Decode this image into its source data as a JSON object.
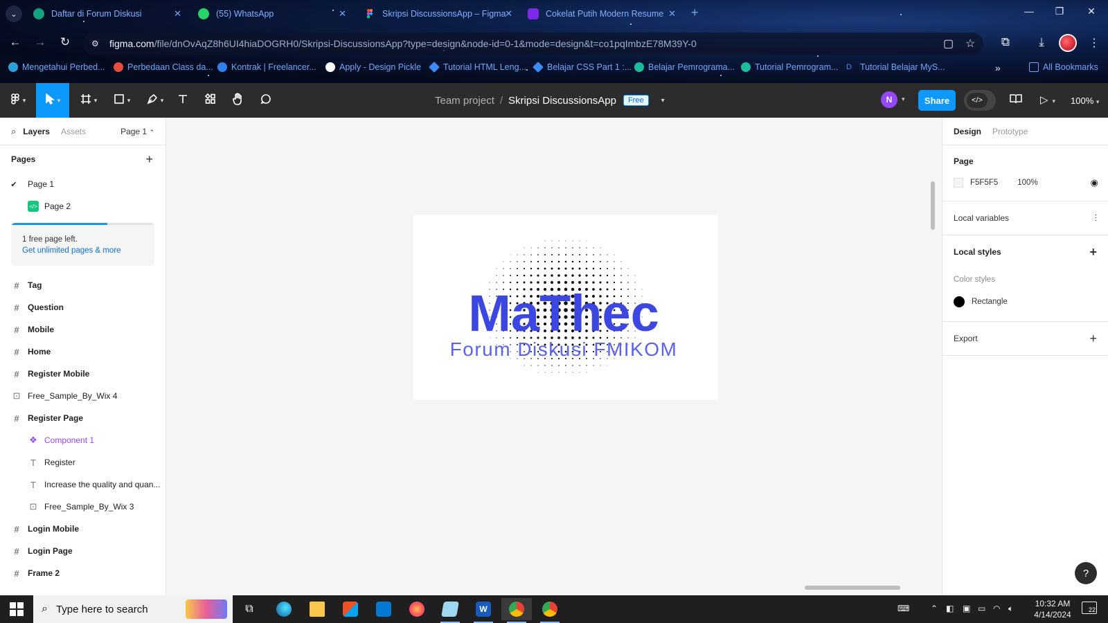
{
  "browser": {
    "tabs": [
      {
        "title": "Daftar di Forum Diskusi",
        "icon": "chatgpt-icon",
        "color": "#10a37f"
      },
      {
        "title": "(55) WhatsApp",
        "icon": "whatsapp-icon",
        "color": "#25d366"
      },
      {
        "title": "Skripsi DiscussionsApp – Figma",
        "icon": "figma-icon",
        "color": "#f24e1e"
      },
      {
        "title": "Cokelat Putih Modern Resume",
        "icon": "canva-icon",
        "color": "#7d2ae8"
      }
    ],
    "url_host": "figma.com",
    "url_path": "/file/dnOvAqZ8h6UI4hiaDOGRH0/Skripsi-DiscussionsApp?type=design&node-id=0-1&mode=design&t=co1pqImbzE78M39Y-0",
    "bookmarks": [
      {
        "label": "Mengetahui Perbed...",
        "color": "#2b9fd9"
      },
      {
        "label": "Perbedaan Class da...",
        "color": "#e74c3c"
      },
      {
        "label": "Kontrak | Freelancer...",
        "color": "#2f80ed"
      },
      {
        "label": "Apply - Design Pickle",
        "color": "#ffffff"
      },
      {
        "label": "Tutorial HTML Leng...",
        "color": "#3d8bff"
      },
      {
        "label": "Belajar CSS Part 1 :...",
        "color": "#3d8bff"
      },
      {
        "label": "Belajar Pemrograma...",
        "color": "#1abc9c"
      },
      {
        "label": "Tutorial Pemrogram...",
        "color": "#1abc9c"
      },
      {
        "label": "Tutorial Belajar MyS...",
        "color": "#3d8bff"
      }
    ],
    "all_bookmarks": "All Bookmarks"
  },
  "figma": {
    "toolbar": {
      "team": "Team project",
      "separator": "/",
      "file_name": "Skripsi DiscussionsApp",
      "plan_badge": "Free",
      "avatar_initial": "N",
      "share_label": "Share",
      "zoom": "100%"
    },
    "left_panel": {
      "tab_layers": "Layers",
      "tab_assets": "Assets",
      "page_selector": "Page 1",
      "pages_header": "Pages",
      "pages": [
        {
          "name": "Page 1",
          "current": true
        },
        {
          "name": "Page 2",
          "current": false
        }
      ],
      "upsell_line1": "1 free page left.",
      "upsell_link": "Get unlimited pages & more",
      "upsell_progress": 0.67,
      "layers": [
        {
          "name": "Tag",
          "type": "frame",
          "depth": 0
        },
        {
          "name": "Question",
          "type": "frame",
          "depth": 0
        },
        {
          "name": "Mobile",
          "type": "frame",
          "depth": 0
        },
        {
          "name": "Home",
          "type": "frame",
          "depth": 0
        },
        {
          "name": "Register Mobile",
          "type": "frame",
          "depth": 0
        },
        {
          "name": "Free_Sample_By_Wix 4",
          "type": "image",
          "depth": 0
        },
        {
          "name": "Register Page",
          "type": "frame",
          "depth": 0
        },
        {
          "name": "Component 1",
          "type": "component",
          "depth": 1
        },
        {
          "name": "Register",
          "type": "text",
          "depth": 1
        },
        {
          "name": "Increase the quality and quan...",
          "type": "text",
          "depth": 1
        },
        {
          "name": "Free_Sample_By_Wix 3",
          "type": "image",
          "depth": 1
        },
        {
          "name": "Login Mobile",
          "type": "frame",
          "depth": 0
        },
        {
          "name": "Login Page",
          "type": "frame",
          "depth": 0
        },
        {
          "name": "Frame 2",
          "type": "frame",
          "depth": 0
        }
      ]
    },
    "canvas": {
      "logo_title": "MaThec",
      "logo_subtitle": "Forum Diskusi FMIKOM",
      "logo_color": "#3b47e0"
    },
    "right_panel": {
      "tab_design": "Design",
      "tab_prototype": "Prototype",
      "page_section": "Page",
      "page_color": "F5F5F5",
      "page_opacity": "100%",
      "local_variables": "Local variables",
      "local_styles": "Local styles",
      "color_styles": "Color styles",
      "color_style_name": "Rectangle",
      "export": "Export"
    }
  },
  "taskbar": {
    "search_placeholder": "Type here to search",
    "time": "10:32 AM",
    "date": "4/14/2024",
    "notifications": "22"
  }
}
